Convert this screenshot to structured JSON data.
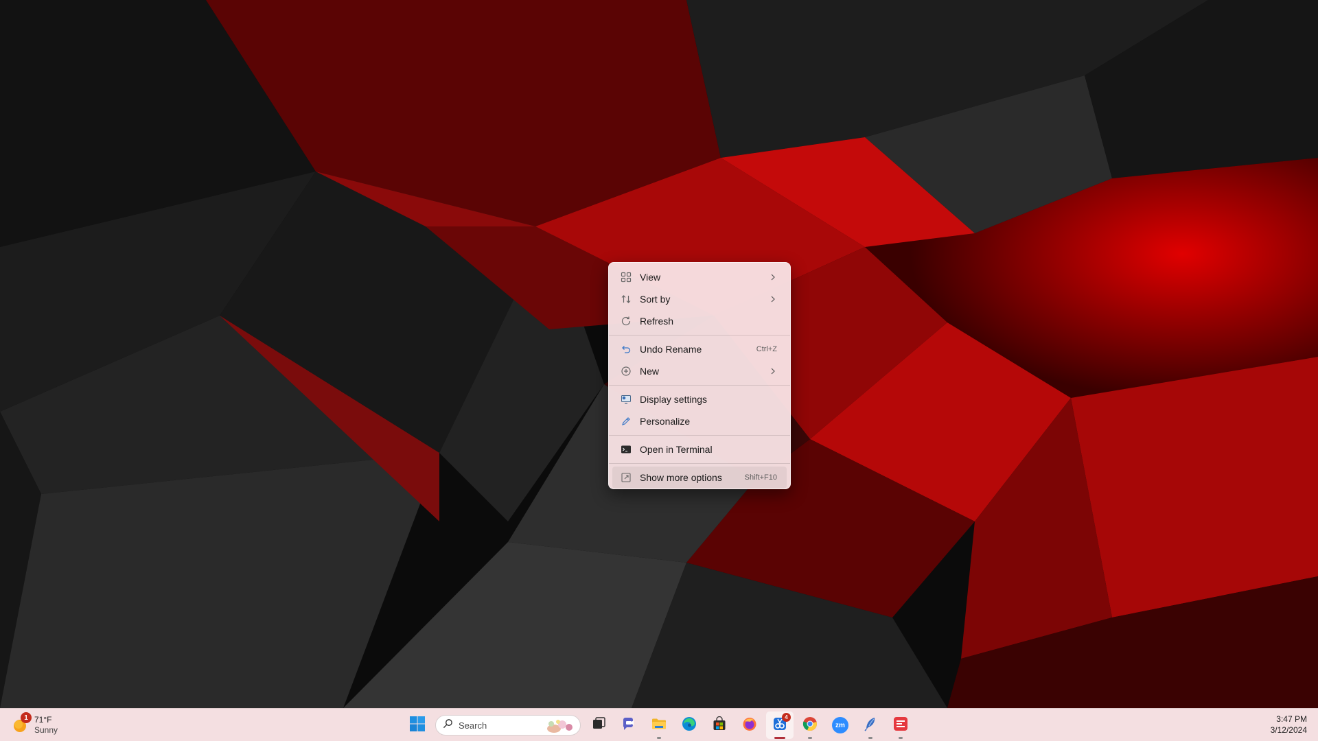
{
  "context_menu": {
    "items": [
      {
        "label": "View",
        "icon": "grid-view-icon",
        "submenu": true
      },
      {
        "label": "Sort by",
        "icon": "sort-arrows-icon",
        "submenu": true
      },
      {
        "label": "Refresh",
        "icon": "refresh-icon",
        "submenu": false
      },
      {
        "label": "Undo Rename",
        "icon": "undo-icon",
        "shortcut": "Ctrl+Z"
      },
      {
        "label": "New",
        "icon": "plus-circle-icon",
        "submenu": true
      },
      {
        "label": "Display settings",
        "icon": "display-settings-icon"
      },
      {
        "label": "Personalize",
        "icon": "pencil-icon"
      },
      {
        "label": "Open in Terminal",
        "icon": "terminal-icon"
      },
      {
        "label": "Show more options",
        "icon": "show-more-icon",
        "shortcut": "Shift+F10"
      }
    ]
  },
  "taskbar": {
    "weather": {
      "temp": "71°F",
      "condition": "Sunny",
      "badge": "1"
    },
    "search": {
      "label": "Search"
    },
    "apps": [
      {
        "name": "start-button",
        "icon": "windows-logo-icon"
      },
      {
        "name": "task-view",
        "icon": "task-view-icon"
      },
      {
        "name": "teams-chat",
        "icon": "teams-icon"
      },
      {
        "name": "file-explorer",
        "icon": "folder-icon"
      },
      {
        "name": "edge",
        "icon": "edge-icon"
      },
      {
        "name": "store",
        "icon": "store-icon"
      },
      {
        "name": "firefox",
        "icon": "firefox-icon"
      },
      {
        "name": "snipping-tool",
        "icon": "snipping-tool-icon",
        "badge": "4"
      },
      {
        "name": "chrome",
        "icon": "chrome-icon"
      },
      {
        "name": "zoom",
        "icon": "zoom-icon",
        "text": "zm"
      },
      {
        "name": "feather-app",
        "icon": "feather-icon"
      },
      {
        "name": "red-app",
        "icon": "red-app-icon"
      }
    ],
    "clock": {
      "time": "3:47 PM",
      "date": "3/12/2024"
    }
  },
  "colors": {
    "menu_bg": "#f8e2e4",
    "taskbar_bg": "#f4dfe1",
    "accent_red": "#c42b1c",
    "wallpaper_red": "#b00000"
  }
}
